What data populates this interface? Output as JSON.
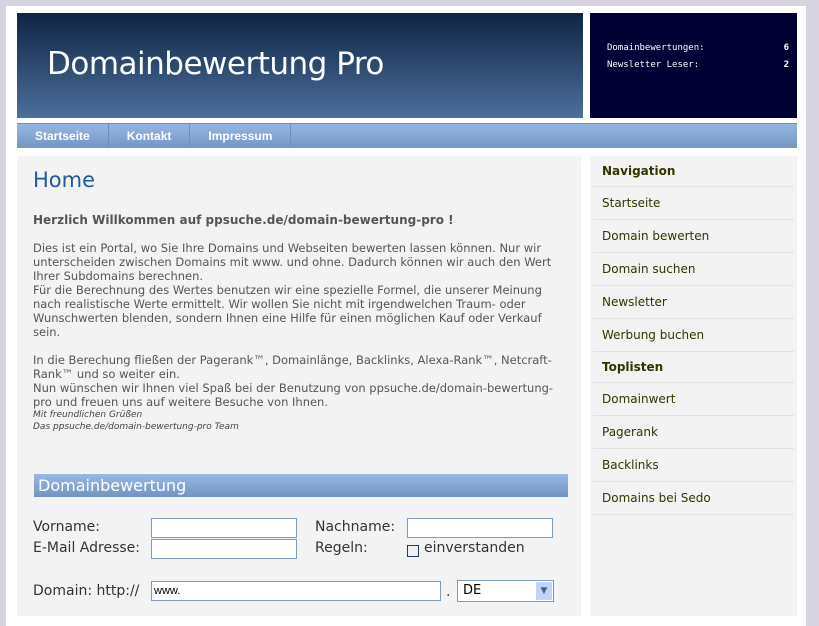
{
  "header": {
    "title": "Domainbewertung Pro"
  },
  "stats": [
    {
      "label": "Domainbewertungen:",
      "value": "6"
    },
    {
      "label": "Newsletter Leser:",
      "value": "2"
    }
  ],
  "topnav": [
    "Startseite",
    "Kontakt",
    "Impressum"
  ],
  "main": {
    "heading": "Home",
    "welcome": "Herzlich Willkommen auf ppsuche.de/domain-bewertung-pro !",
    "p1a": "Dies ist ein Portal, wo Sie Ihre Domains und Webseiten bewerten lassen können. Nur wir unterscheiden zwischen Domains mit www. und ohne. Dadurch können wir auch den Wert Ihrer Subdomains berechnen.",
    "p1b": "Für die Berechnung des Wertes benutzen wir eine spezielle Formel, die unserer Meinung nach realistische Werte ermittelt. Wir wollen Sie nicht mit irgendwelchen Traum- oder Wunschwerten blenden, sondern Ihnen eine Hilfe für einen möglichen Kauf oder Verkauf sein.",
    "p2a": "In die Berechung fließen der Pagerank™, Domainlänge, Backlinks, Alexa-Rank™, Netcraft-Rank™ und so weiter ein.",
    "p2b": "Nun wünschen wir Ihnen viel Spaß bei der Benutzung von ppsuche.de/domain-bewertung-pro und freuen uns auf weitere Besuche von Ihnen.",
    "sig1": "Mit freundlichen Grüßen",
    "sig2": "Das ppsuche.de/domain-bewertung-pro Team"
  },
  "form": {
    "title": "Domainbewertung",
    "vorname_label": "Vorname:",
    "vorname": "",
    "nachname_label": "Nachname:",
    "nachname": "",
    "email_label": "E-Mail Adresse:",
    "email": "",
    "regeln_label": "Regeln:",
    "checkbox_label": "einverstanden",
    "checked": false,
    "domain_label": "Domain: http://",
    "domain_value": "www.",
    "dot": ".",
    "tld": "DE"
  },
  "sidebar": {
    "nav_title": "Navigation",
    "nav": [
      "Startseite",
      "Domain bewerten",
      "Domain suchen",
      "Newsletter",
      "Werbung buchen"
    ],
    "top_title": "Toplisten",
    "top": [
      "Domainwert",
      "Pagerank",
      "Backlinks",
      "Domains bei Sedo"
    ]
  }
}
